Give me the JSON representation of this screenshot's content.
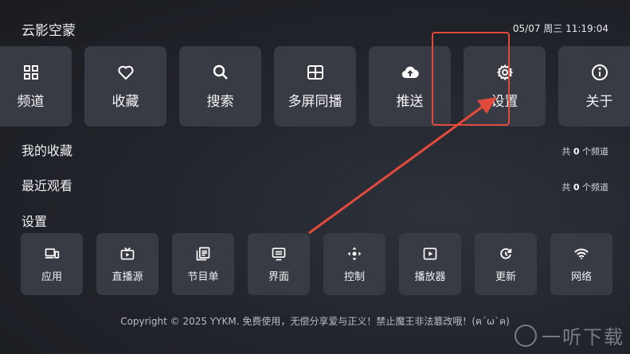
{
  "header": {
    "app_title": "云影空蒙",
    "datetime": "05/07 周三 11:19:04"
  },
  "main_tiles": [
    {
      "label": "频道",
      "icon": "grid-icon"
    },
    {
      "label": "收藏",
      "icon": "heart-icon"
    },
    {
      "label": "搜索",
      "icon": "search-icon"
    },
    {
      "label": "多屏同播",
      "icon": "multiscreen-icon"
    },
    {
      "label": "推送",
      "icon": "cloud-upload-icon"
    },
    {
      "label": "设置",
      "icon": "gear-icon"
    },
    {
      "label": "关于",
      "icon": "info-icon"
    }
  ],
  "sections": {
    "favorites": {
      "title": "我的收藏",
      "count_prefix": "共",
      "count": "0",
      "count_suffix": "个频道"
    },
    "recent": {
      "title": "最近观看",
      "count_prefix": "共",
      "count": "0",
      "count_suffix": "个频道"
    },
    "settings": {
      "title": "设置"
    }
  },
  "settings_tiles": [
    {
      "label": "应用",
      "icon": "devices-icon"
    },
    {
      "label": "直播源",
      "icon": "tv-icon"
    },
    {
      "label": "节目单",
      "icon": "list-icon"
    },
    {
      "label": "界面",
      "icon": "screen-icon"
    },
    {
      "label": "控制",
      "icon": "dpad-icon"
    },
    {
      "label": "播放器",
      "icon": "play-icon"
    },
    {
      "label": "更新",
      "icon": "refresh-icon"
    },
    {
      "label": "网络",
      "icon": "wifi-icon"
    }
  ],
  "footer": {
    "copyright": "Copyright © 2025 YYKM. 免费使用，无偿分享爱与正义！禁止魔王非法篡改哦！(ฅ´ω`ฅ)"
  },
  "watermark": {
    "text": "一听下载"
  },
  "colors": {
    "highlight": "#e24a3b",
    "tile_bg": "#383b43"
  }
}
